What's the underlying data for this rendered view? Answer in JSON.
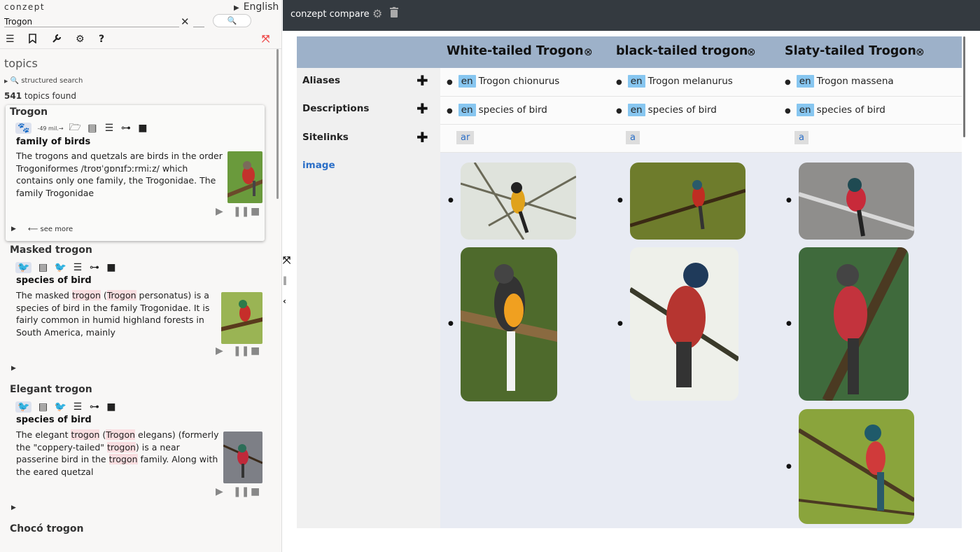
{
  "sidebar": {
    "brand": "conzept",
    "language": "English",
    "search_value": "Trogon",
    "topics_heading": "topics",
    "structured_search": "structured search",
    "found_count": "541",
    "found_suffix": " topics found",
    "see_more": "⟵ see more",
    "cards": [
      {
        "title": "Trogon",
        "small_label": "-49 mil.→",
        "label": "family of birds",
        "text": "The trogons and quetzals are birds in the order Trogoniformes /troʊˈɡɒnɪfɔːrmiːz/ which contains only one family, the Trogonidae. The family Trogonidae"
      },
      {
        "title": "Masked trogon",
        "label": "species of bird",
        "text_parts": [
          "The masked ",
          "trogon",
          " (",
          "Trogon",
          " personatus) is a species of bird in the family Trogonidae. It is fairly common in humid highland forests in South America, mainly"
        ]
      },
      {
        "title": "Elegant trogon",
        "label": "species of bird",
        "text_parts": [
          "The elegant ",
          "trogon",
          " (",
          "Trogon",
          " elegans) (formerly the \"coppery-tailed\" ",
          "trogon",
          ") is a near passerine bird in the ",
          "trogon",
          " family. Along with the eared quetzal"
        ]
      },
      {
        "title": "Chocó trogon"
      }
    ]
  },
  "topbar": {
    "title": "conzept compare"
  },
  "compare": {
    "row_labels": {
      "aliases": "Aliases",
      "descriptions": "Descriptions",
      "sitelinks": "Sitelinks",
      "image": "image"
    },
    "columns": [
      {
        "title": "White-tailed Trogon",
        "alias": "Trogon chionurus",
        "description": "species of bird",
        "sitelink": "ar",
        "lang": "en"
      },
      {
        "title": "black-tailed trogon",
        "alias": "Trogon melanurus",
        "description": "species of bird",
        "sitelink": "a",
        "lang": "en"
      },
      {
        "title": "Slaty-tailed Trogon",
        "alias": "Trogon massena",
        "description": "species of bird",
        "sitelink": "a",
        "lang": "en"
      }
    ]
  }
}
